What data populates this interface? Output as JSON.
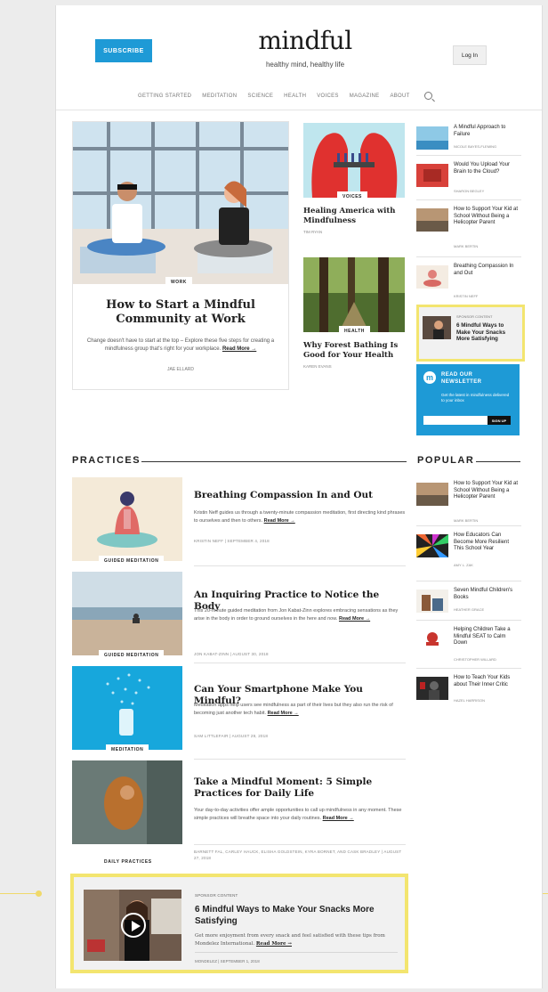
{
  "header": {
    "subscribe": "SUBSCRIBE",
    "logo": "mindful",
    "tagline": "healthy mind, healthy life",
    "login": "Log In",
    "nav": [
      "GETTING STARTED",
      "MEDITATION",
      "SCIENCE",
      "HEALTH",
      "VOICES",
      "MAGAZINE",
      "ABOUT"
    ]
  },
  "feature": {
    "tag": "WORK",
    "title": "How to Start a Mindful Community at Work",
    "desc": "Change doesn't have to start at the top – Explore these five steps for creating a mindfulness group that's right for your workplace.",
    "readmore": "Read More →",
    "author": "JAE ELLARD"
  },
  "stories": [
    {
      "tag": "VOICES",
      "title": "Healing America with Mindfulness",
      "author": "TIM RYAN"
    },
    {
      "tag": "HEALTH",
      "title": "Why Forest Bathing Is Good for Your Health",
      "author": "KAREN EVANS"
    }
  ],
  "right_list": [
    {
      "title": "A Mindful Approach to Failure",
      "author": "NICOLE BAYES-FLEMING"
    },
    {
      "title": "Would You Upload Your Brain to the Cloud?",
      "author": "SHARON BEGLEY"
    },
    {
      "title": "How to Support Your Kid at School Without Being a Helicopter Parent",
      "author": "MARK BERTIN"
    },
    {
      "title": "Breathing Compassion In and Out",
      "author": "KRISTIN NEFF"
    }
  ],
  "sponsor_right": {
    "label": "SPONSOR CONTENT",
    "title": "6 Mindful Ways to Make Your Snacks More Satisfying"
  },
  "newsletter": {
    "title": "READ OUR NEWSLETTER",
    "desc": "Get the latest in mindfulness delivered to your inbox",
    "button": "SIGN UP"
  },
  "practices": {
    "heading": "PRACTICES",
    "items": [
      {
        "tag": "GUIDED MEDITATION",
        "title": "Breathing Compassion In and Out",
        "desc": "Kristin Neff guides us through a twenty-minute compassion meditation, first directing kind phrases to ourselves and then to others.",
        "readmore": "Read More →",
        "meta": "KRISTIN NEFF  |  SEPTEMBER 4, 2018"
      },
      {
        "tag": "GUIDED MEDITATION",
        "title": "An Inquiring Practice to Notice the Body",
        "desc": "This 20-minute guided meditation from Jon Kabat-Zinn explores embracing sensations as they arise in the body in order to ground ourselves in the here and now.",
        "readmore": "Read More →",
        "meta": "JON KABAT-ZINN  |  AUGUST 30, 2018"
      },
      {
        "tag": "MEDITATION",
        "title": "Can Your Smartphone Make You Mindful?",
        "desc": "Meditation apps help users see mindfulness as part of their lives but they also run the risk of becoming just another tech habit.",
        "readmore": "Read More →",
        "meta": "SAM LITTLEFAIR  |  AUGUST 29, 2018"
      },
      {
        "tag": "DAILY PRACTICES",
        "title": "Take a Mindful Moment: 5 Simple Practices for Daily Life",
        "desc": "Your day-to-day activities offer ample opportunities to call up mindfulness in any moment. These simple practices will breathe space into your daily routines.",
        "readmore": "Read More →",
        "meta": "BARNETT FAL, CARLEY HAUCK, ELISHA GOLDSTEIN, KYRA BORNET, AND CASK BRADLEY  |  AUGUST 27, 2018"
      }
    ]
  },
  "popular": {
    "heading": "POPULAR",
    "items": [
      {
        "title": "How to Support Your Kid at School Without Being a Helicopter Parent",
        "author": "MARK BERTIN"
      },
      {
        "title": "How Educators Can Become More Resilient This School Year",
        "author": "AMY L. ZAK"
      },
      {
        "title": "Seven Mindful Children's Books",
        "author": "HEATHER GRACE"
      },
      {
        "title": "Helping Children Take a Mindful SEAT to Calm Down",
        "author": "CHRISTOPHER WILLARD"
      },
      {
        "title": "How to Teach Your Kids about Their Inner Critic",
        "author": "HAZEL HARRISON"
      }
    ]
  },
  "sponsor_bottom": {
    "label": "SPONSOR CONTENT",
    "title": "6 Mindful Ways to Make Your Snacks More Satisfying",
    "desc": "Get more enjoyment from every snack and feel satisfied with these tips from Mondelez International.",
    "readmore": "Read More →",
    "meta": "MONDELEZ  |  SEPTEMBER 1, 2018"
  },
  "colors": {
    "accent": "#1e9ad6",
    "highlight": "#f3e56f"
  }
}
